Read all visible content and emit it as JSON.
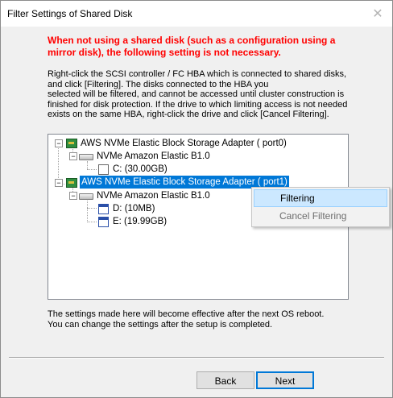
{
  "window": {
    "title": "Filter Settings of Shared Disk",
    "close_glyph": "✕"
  },
  "warning": "When not using a shared disk (such as a configuration using a mirror disk), the following setting is not necessary.",
  "instructions": [
    "Right-click the SCSI controller / FC HBA which is connected to shared disks,",
    "and click [Filtering].  The disks connected to the HBA you",
    "selected will be filtered, and cannot be accessed until cluster construction is",
    "finished for disk protection. If the drive to which limiting access is not needed",
    "exists on the same HBA, right-click the drive and click [Cancel Filtering]."
  ],
  "tree": {
    "adapters": [
      {
        "label": "AWS NVMe Elastic Block Storage Adapter ( port0)",
        "expander": "−",
        "disk": {
          "label": "NVMe     Amazon Elastic B1.0",
          "expander": "−"
        },
        "volumes": [
          {
            "label": "C:  (30.00GB)"
          }
        ]
      },
      {
        "label": "AWS NVMe Elastic Block Storage Adapter ( port1)",
        "expander": "−",
        "selected": true,
        "disk": {
          "label": "NVMe     Amazon Elastic B1.0",
          "expander": "−"
        },
        "volumes": [
          {
            "label": "D:  (10MB)"
          },
          {
            "label": "E:  (19.99GB)"
          }
        ]
      }
    ]
  },
  "context_menu": {
    "items": [
      {
        "label": "Filtering",
        "state": "hover"
      },
      {
        "label": "Cancel Filtering",
        "state": "disabled"
      }
    ]
  },
  "footer_note": [
    "The settings made here will become effective after the next OS reboot.",
    "You can change the settings after the setup is completed."
  ],
  "buttons": {
    "back": "Back",
    "next": "Next"
  },
  "colors": {
    "warning": "#ff0000",
    "selection": "#0078d7",
    "menu_hover": "#cce8ff"
  }
}
